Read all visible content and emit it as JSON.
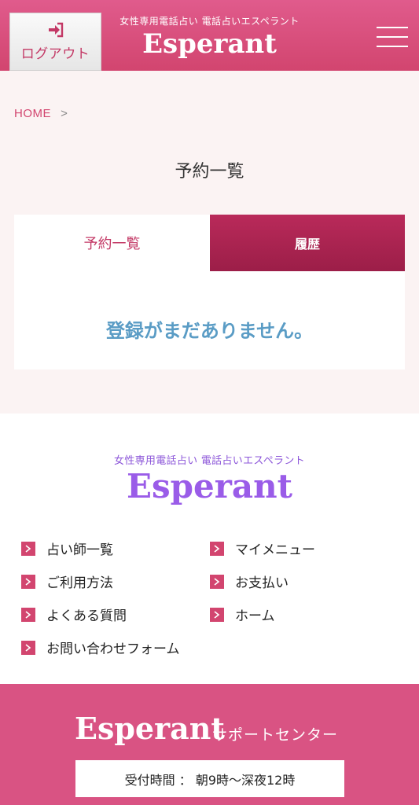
{
  "header": {
    "logout_label": "ログアウト",
    "brand_sub": "女性専用電話占い 電話占いエスペラント",
    "brand": "Esperant"
  },
  "breadcrumb": {
    "home": "HOME",
    "separator": ">"
  },
  "page_title": "予約一覧",
  "tabs": [
    {
      "label": "予約一覧",
      "active": true
    },
    {
      "label": "履歴",
      "active": false
    }
  ],
  "empty_message": "登録がまだありません。",
  "footer": {
    "brand_sub": "女性専用電話占い 電話占いエスペラント",
    "brand": "Esperant",
    "nav": [
      {
        "label": "占い師一覧"
      },
      {
        "label": "マイメニュー"
      },
      {
        "label": "ご利用方法"
      },
      {
        "label": "お支払い"
      },
      {
        "label": "よくある質問"
      },
      {
        "label": "ホーム"
      },
      {
        "label": "お問い合わせフォーム"
      }
    ]
  },
  "support": {
    "brand": "Esperant",
    "center": "サポートセンター",
    "hours": "受付時間 ： 朝9時〜深夜12時"
  },
  "colors": {
    "header": "#d2456f",
    "tab_inactive": "#a8234f",
    "empty_text": "#5a9cc5",
    "footer_brand": "#9a5ce8",
    "support_band": "#d95383"
  },
  "icons": {
    "logout": "sign-in-arrow-icon",
    "menu": "hamburger-icon",
    "nav_bullet": "chevron-right-icon"
  }
}
